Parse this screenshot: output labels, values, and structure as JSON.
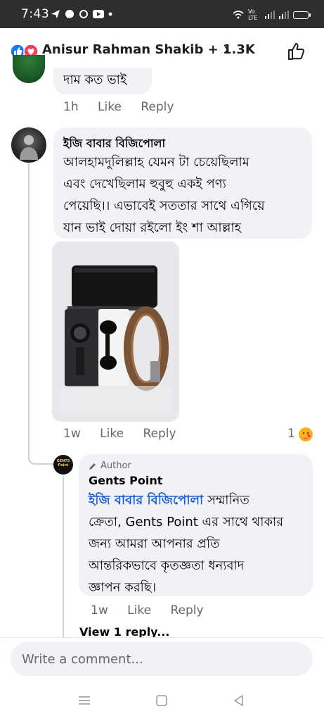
{
  "status_bar": {
    "time": "7:43",
    "network": "Vo LTE"
  },
  "header": {
    "title": "Anisur Rahman Shakib + 1.3K",
    "chevron": "›"
  },
  "top_comment": {
    "text": "দাম কত ভাই",
    "time": "1h",
    "like": "Like",
    "reply": "Reply"
  },
  "comment": {
    "author": "ইজি বাবার বিজিপোলা",
    "lines": [
      "আলহামদুলিল্লাহ যেমন টা চেয়েছিলাম",
      "এবং দেখেছিলাম হুবুহু একই পণ্য",
      "পেয়েছি।। এভাবেই সততার সাথে এগিয়ে",
      "যান ভাই দোয়া রইলো ইং শা আল্লাহ"
    ],
    "time": "1w",
    "like": "Like",
    "reply": "Reply",
    "reaction_count": "1"
  },
  "reply": {
    "badge": "Author",
    "author": "Gents Point",
    "avatar_text": "GENTS Point",
    "mention": "ইজি বাবার বিজিপোলা",
    "line1_rest": " সম্মানিত",
    "lines": [
      "ক্রেতা, Gents Point এর সাথে থাকার",
      "জন্য আমরা আপনার প্রতি",
      "আন্তরিকভাবে কৃতজ্ঞতা ধন্যবাদ",
      "জ্ঞাপন করছি।"
    ],
    "time": "1w",
    "like": "Like",
    "reply": "Reply"
  },
  "view_replies": "View 1 reply...",
  "composer": {
    "placeholder": "Write a comment..."
  },
  "colors": {
    "like_blue": "#1877f2",
    "love_red": "#f33e58",
    "mention_blue": "#1a5dd6",
    "meta_gray": "#65676b"
  }
}
